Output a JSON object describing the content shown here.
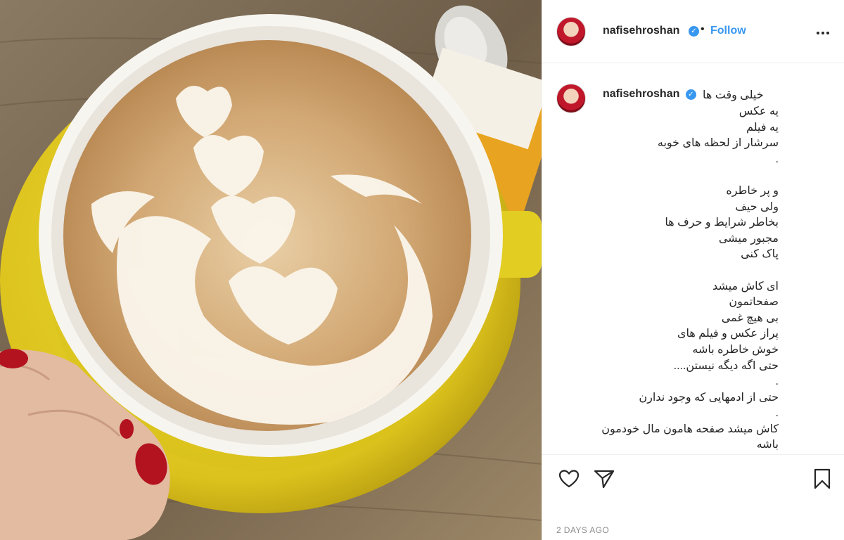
{
  "post": {
    "username": "nafisehroshan",
    "verified_badge": "✓",
    "separator": "•",
    "follow_label": "Follow",
    "caption_first": "خیلی وقت ها",
    "caption_body": "یه عکس\nیه فیلم\nسرشار از لحظه های خوبه\n.\n\nو پر خاطره\nولی حیف\nبخاطر شرایط و حرف ها\nمجبور میشی\nپاک کنی\n\nای کاش میشد\nصفحاتمون\nبی هیچ غمی\nپراز عکس و فیلم های\nخوش خاطره باشه\nحتی اگه دیگه نیستن....\n.\nحتی از ادمهایی که وجود ندارن\n.\nکاش میشد صفحه هامون مال خودمون\nباشه",
    "timestamp": "2 DAYS AGO"
  },
  "icons": {
    "more": "more-options-icon",
    "like": "heart-icon",
    "share": "send-icon",
    "save": "bookmark-icon"
  },
  "colors": {
    "link": "#3897f0",
    "text": "#262626",
    "muted": "#8e8e8e",
    "cup": "#e8d628"
  }
}
